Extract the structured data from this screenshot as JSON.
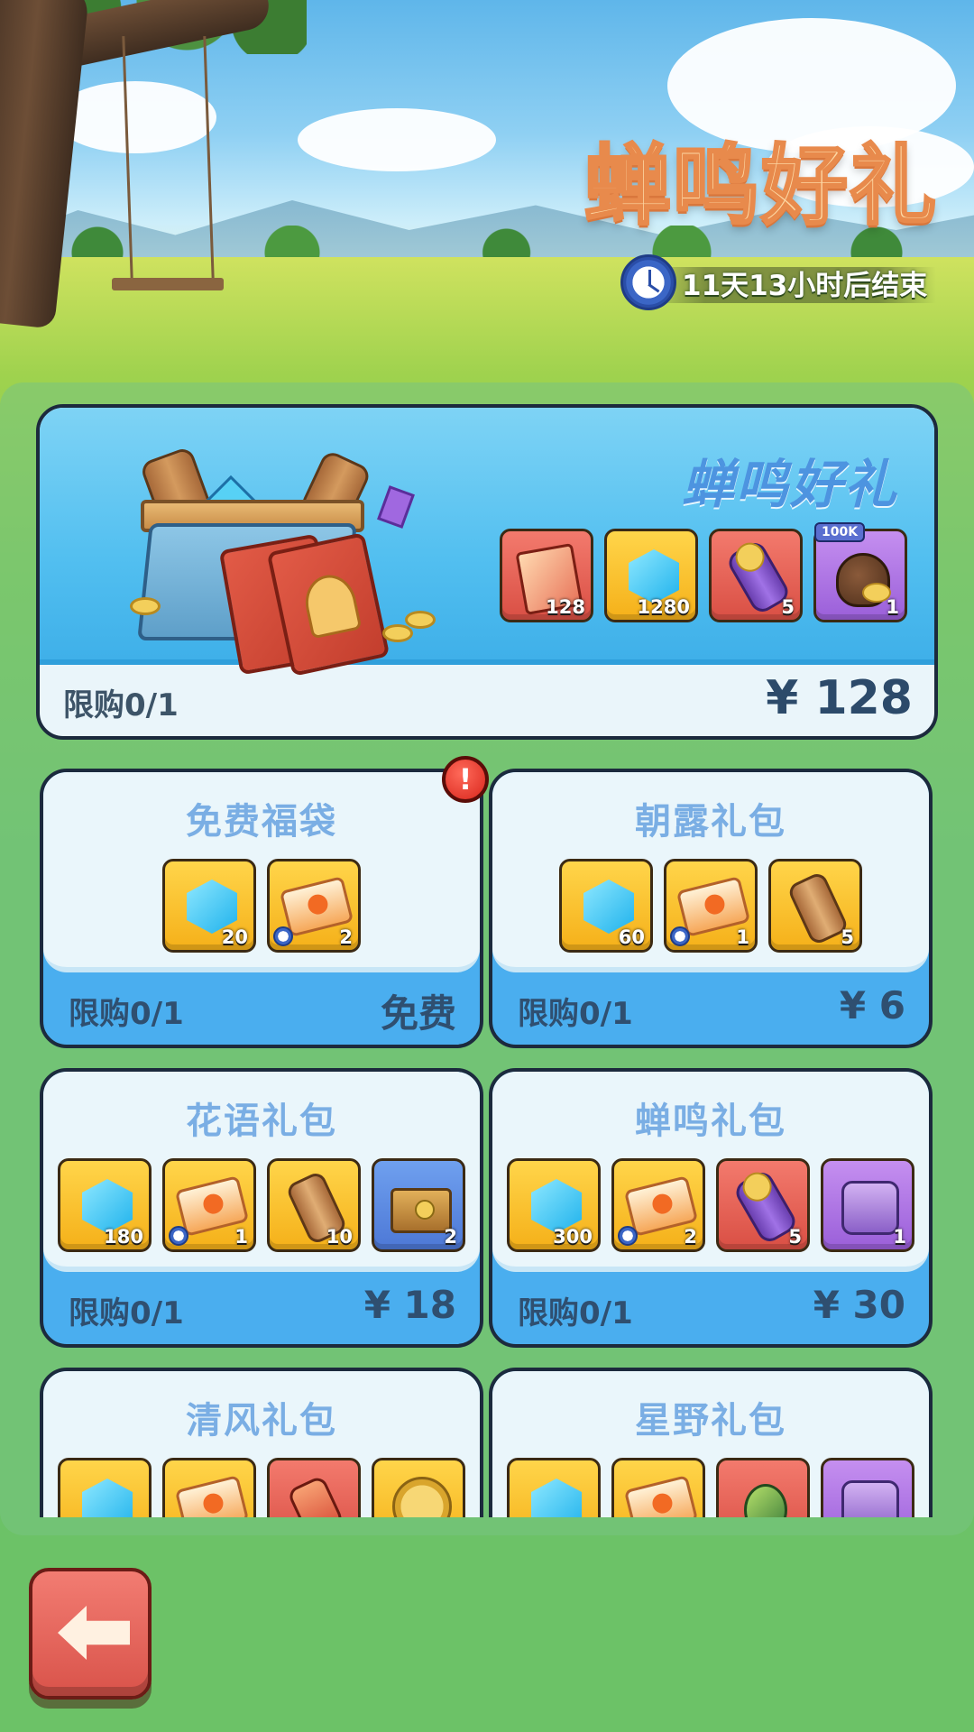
{
  "header": {
    "title": "蝉鸣好礼",
    "timer_text": "11天13小时后结束"
  },
  "featured": {
    "title": "蝉鸣好礼",
    "limit": "限购0/1",
    "price": "¥ 128",
    "items": [
      {
        "icon": "hero-card-icon",
        "color": "red",
        "count": "128"
      },
      {
        "icon": "gem-icon",
        "color": "yellow",
        "count": "1280"
      },
      {
        "icon": "scroll-roll-icon",
        "color": "red",
        "count": "5"
      },
      {
        "icon": "coin-bag-icon",
        "color": "purple",
        "count": "1",
        "badge": "100K"
      }
    ]
  },
  "gifts": [
    {
      "name": "免费福袋",
      "limit": "限购0/1",
      "price": "免费",
      "alert": "!",
      "items": [
        {
          "icon": "gem-icon",
          "color": "yellow",
          "count": "20"
        },
        {
          "icon": "ticket-icon",
          "color": "yellow",
          "count": "2",
          "timed": true
        }
      ]
    },
    {
      "name": "朝露礼包",
      "limit": "限购0/1",
      "price": "¥ 6",
      "items": [
        {
          "icon": "gem-icon",
          "color": "yellow",
          "count": "60"
        },
        {
          "icon": "ticket-icon",
          "color": "yellow",
          "count": "1",
          "timed": true
        },
        {
          "icon": "scroll-icon",
          "color": "yellow",
          "count": "5"
        }
      ]
    },
    {
      "name": "花语礼包",
      "limit": "限购0/1",
      "price": "¥ 18",
      "items": [
        {
          "icon": "gem-icon",
          "color": "yellow",
          "count": "180"
        },
        {
          "icon": "ticket-icon",
          "color": "yellow",
          "count": "1",
          "timed": true
        },
        {
          "icon": "scroll-icon",
          "color": "yellow",
          "count": "10"
        },
        {
          "icon": "treasure-chest-icon",
          "color": "blue",
          "count": "2"
        }
      ]
    },
    {
      "name": "蝉鸣礼包",
      "limit": "限购0/1",
      "price": "¥ 30",
      "items": [
        {
          "icon": "gem-icon",
          "color": "yellow",
          "count": "300"
        },
        {
          "icon": "ticket-icon",
          "color": "yellow",
          "count": "2",
          "timed": true
        },
        {
          "icon": "scroll-roll-icon",
          "color": "red",
          "count": "5"
        },
        {
          "icon": "mask-chest-icon",
          "color": "purple",
          "count": "1"
        }
      ]
    },
    {
      "name": "清风礼包",
      "items": [
        {
          "icon": "gem-icon",
          "color": "yellow"
        },
        {
          "icon": "ticket-icon",
          "color": "yellow"
        },
        {
          "icon": "potion-icon",
          "color": "red"
        },
        {
          "icon": "coin-icon",
          "color": "yellow"
        }
      ]
    },
    {
      "name": "星野礼包",
      "items": [
        {
          "icon": "gem-icon",
          "color": "yellow"
        },
        {
          "icon": "ticket-icon",
          "color": "yellow"
        },
        {
          "icon": "egg-icon",
          "color": "red"
        },
        {
          "icon": "mask-chest-icon",
          "color": "purple"
        }
      ]
    }
  ],
  "colors": {
    "title_fill": "#fdd8a4",
    "title_stroke": "#e88a4c",
    "card_blue": "#4aaeef",
    "back_button": "#e0605a"
  },
  "back_button": {
    "icon": "back-arrow-icon"
  }
}
